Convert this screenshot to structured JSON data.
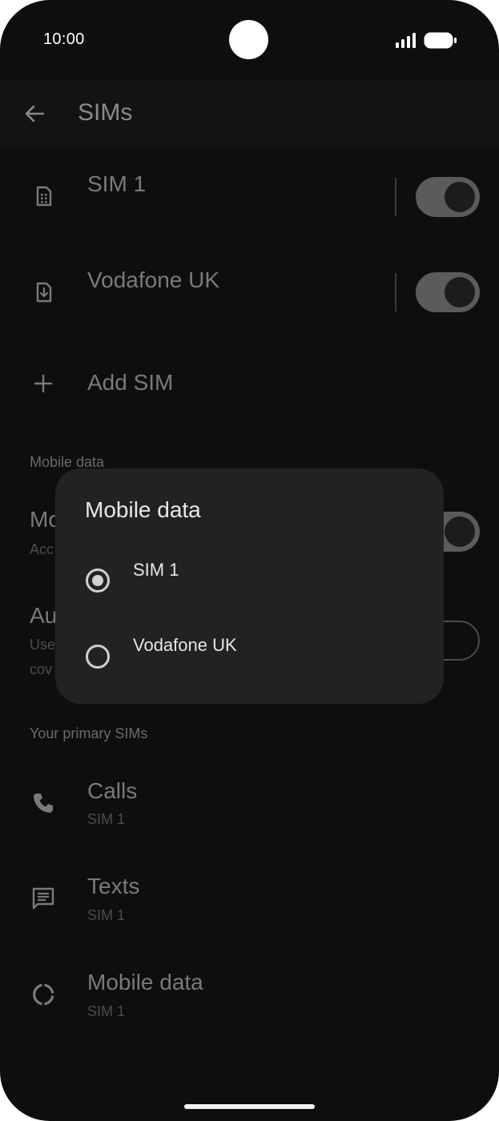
{
  "status_bar": {
    "time": "10:00"
  },
  "app_bar": {
    "title": "SIMs"
  },
  "sims": [
    {
      "name": "SIM 1",
      "icon": "sim-card-icon",
      "enabled": true
    },
    {
      "name": "Vodafone UK",
      "icon": "esim-download-icon",
      "enabled": true
    }
  ],
  "add_sim": {
    "label": "Add SIM",
    "icon": "plus-icon"
  },
  "mobile_data_section": {
    "header": "Mobile data",
    "row1_title_partial": "Mo",
    "row1_sub_partial": "Acc",
    "row1_toggle": true,
    "row2_title_partial": "Au",
    "row2_sub_partial_1": "Use",
    "row2_sub_partial_2": "cov",
    "row2_toggle": false
  },
  "primary_sims": {
    "header": "Your primary SIMs",
    "items": [
      {
        "title": "Calls",
        "value": "SIM 1",
        "icon": "phone-icon"
      },
      {
        "title": "Texts",
        "value": "SIM 1",
        "icon": "message-icon"
      },
      {
        "title": "Mobile data",
        "value": "SIM 1",
        "icon": "data-usage-icon"
      }
    ]
  },
  "dialog": {
    "title": "Mobile data",
    "options": [
      {
        "label": "SIM 1",
        "selected": true
      },
      {
        "label": "Vodafone UK",
        "selected": false
      }
    ]
  },
  "colors": {
    "background": "#0e0e0e",
    "dialog": "#212222",
    "toggle_on_track": "#5b5b5b"
  }
}
